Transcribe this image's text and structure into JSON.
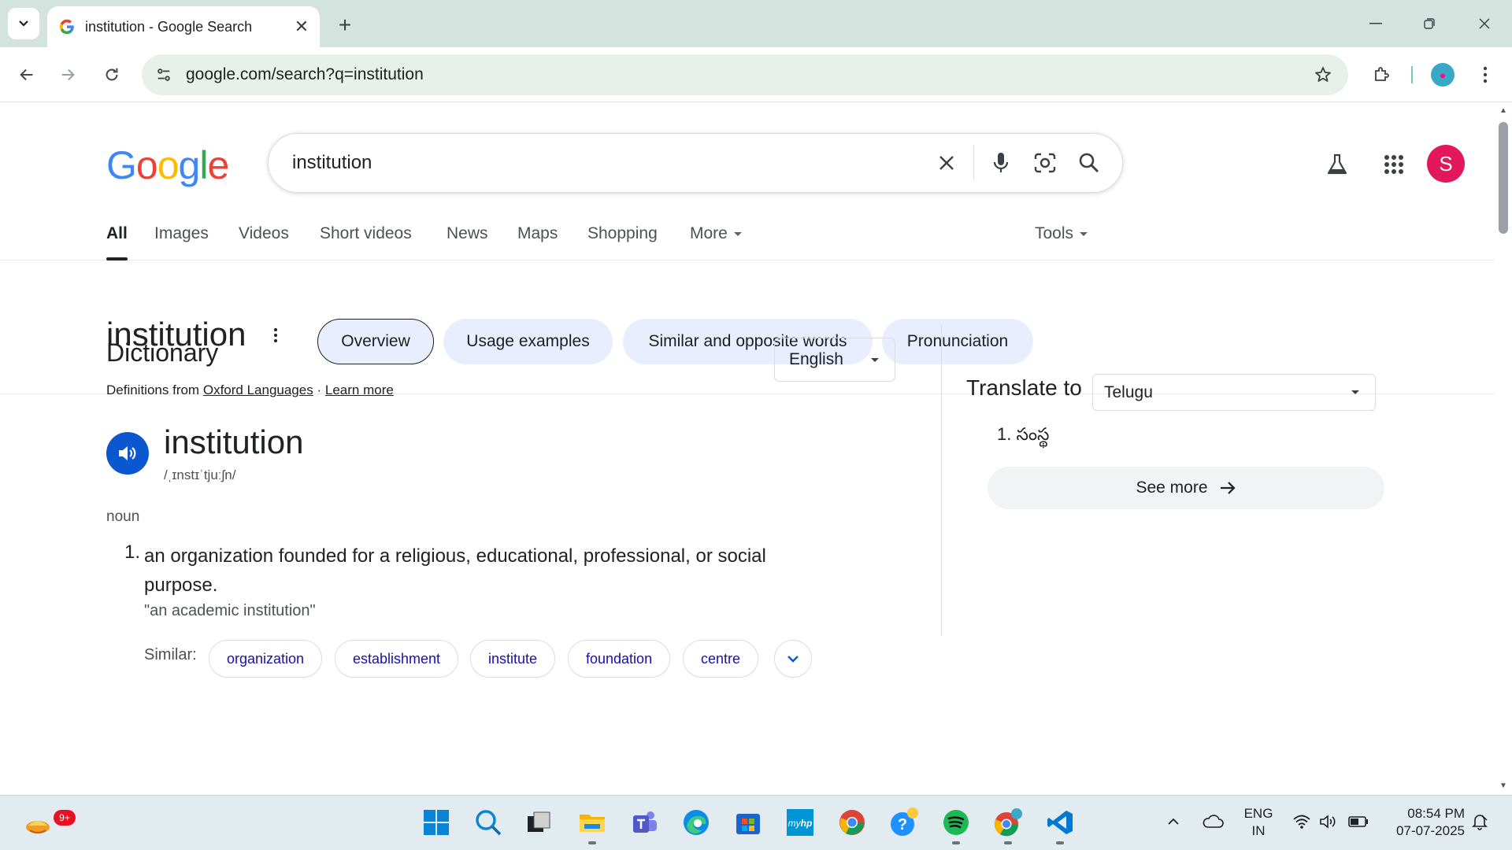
{
  "browser": {
    "tab_title": "institution - Google Search",
    "url": "google.com/search?q=institution",
    "profile_initial": "S"
  },
  "search": {
    "logo_letters": [
      {
        "ch": "G",
        "color": "#4285F4"
      },
      {
        "ch": "o",
        "color": "#EA4335"
      },
      {
        "ch": "o",
        "color": "#FBBC05"
      },
      {
        "ch": "g",
        "color": "#4285F4"
      },
      {
        "ch": "l",
        "color": "#34A853"
      },
      {
        "ch": "e",
        "color": "#EA4335"
      }
    ],
    "query": "institution",
    "avatar_initial": "S"
  },
  "tabs": {
    "all": "All",
    "images": "Images",
    "videos": "Videos",
    "short_videos": "Short videos",
    "news": "News",
    "maps": "Maps",
    "shopping": "Shopping",
    "more": "More",
    "tools": "Tools"
  },
  "word_header": {
    "title": "institution",
    "chips": {
      "overview": "Overview",
      "usage": "Usage examples",
      "similar": "Similar and opposite words",
      "pronunciation": "Pronunciation"
    }
  },
  "dictionary": {
    "title": "Dictionary",
    "source_prefix": "Definitions from",
    "source_link": "Oxford Languages",
    "separator": "·",
    "learn_more": "Learn more",
    "language": "English",
    "headword": "institution",
    "phonetic": "/ˌɪnstɪˈtjuːʃn/",
    "part_of_speech": "noun",
    "definition_number": "1.",
    "definition": "an organization founded for a religious, educational, professional, or social purpose.",
    "example": "\"an academic institution\"",
    "similar_label": "Similar:",
    "synonyms": [
      "organization",
      "establishment",
      "institute",
      "foundation",
      "centre"
    ]
  },
  "translate": {
    "label": "Translate to",
    "language": "Telugu",
    "result": "1. సంస్థ",
    "see_more": "See more"
  },
  "taskbar": {
    "notification_badge": "9+",
    "lang_line1": "ENG",
    "lang_line2": "IN",
    "time": "08:54 PM",
    "date": "07-07-2025"
  },
  "colors": {
    "google_blue": "#4285F4",
    "link_blue": "#1a0dab",
    "chip_bg": "#e8eefe",
    "speaker_blue": "#0b57d0",
    "avatar_pink": "#e3185a"
  }
}
